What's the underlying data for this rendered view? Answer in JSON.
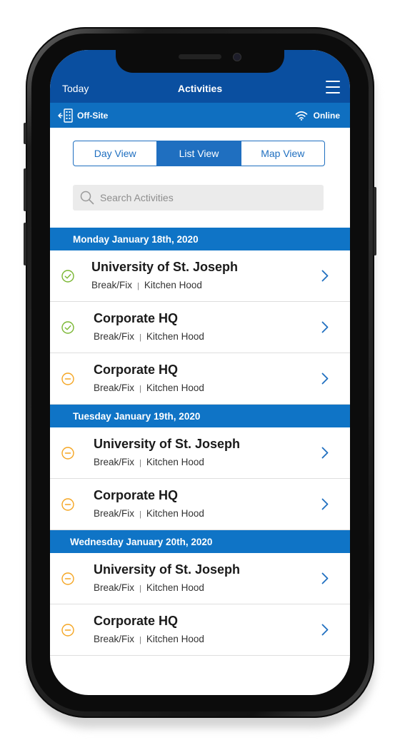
{
  "header": {
    "left_label": "Today",
    "title": "Activities",
    "menu_icon": "hamburger-menu-icon"
  },
  "status_bar": {
    "location_label": "Off-Site",
    "connection_label": "Online"
  },
  "view_tabs": [
    "Day View",
    "List View",
    "Map View"
  ],
  "active_view": "List View",
  "search": {
    "placeholder": "Search Activities"
  },
  "colors": {
    "header": "#0a4fa0",
    "status_bar": "#0f6fc0",
    "accent": "#1f6fc0",
    "completed": "#7ab733",
    "pending": "#f5a623"
  },
  "days": [
    {
      "label": "Monday January 18th, 2020",
      "items": [
        {
          "name": "University of St. Joseph",
          "type": "Break/Fix",
          "detail": "Kitchen Hood",
          "status": "completed"
        },
        {
          "name": "Corporate HQ",
          "type": "Break/Fix",
          "detail": "Kitchen Hood",
          "status": "completed"
        },
        {
          "name": "Corporate HQ",
          "type": "Break/Fix",
          "detail": "Kitchen Hood",
          "status": "pending"
        }
      ]
    },
    {
      "label": "Tuesday January 19th, 2020",
      "items": [
        {
          "name": "University of St. Joseph",
          "type": "Break/Fix",
          "detail": "Kitchen Hood",
          "status": "pending"
        },
        {
          "name": "Corporate HQ",
          "type": "Break/Fix",
          "detail": "Kitchen Hood",
          "status": "pending"
        }
      ]
    },
    {
      "label": "Wednesday January 20th, 2020",
      "items": [
        {
          "name": "University of St. Joseph",
          "type": "Break/Fix",
          "detail": "Kitchen Hood",
          "status": "pending"
        },
        {
          "name": "Corporate HQ",
          "type": "Break/Fix",
          "detail": "Kitchen Hood",
          "status": "pending"
        }
      ]
    }
  ]
}
